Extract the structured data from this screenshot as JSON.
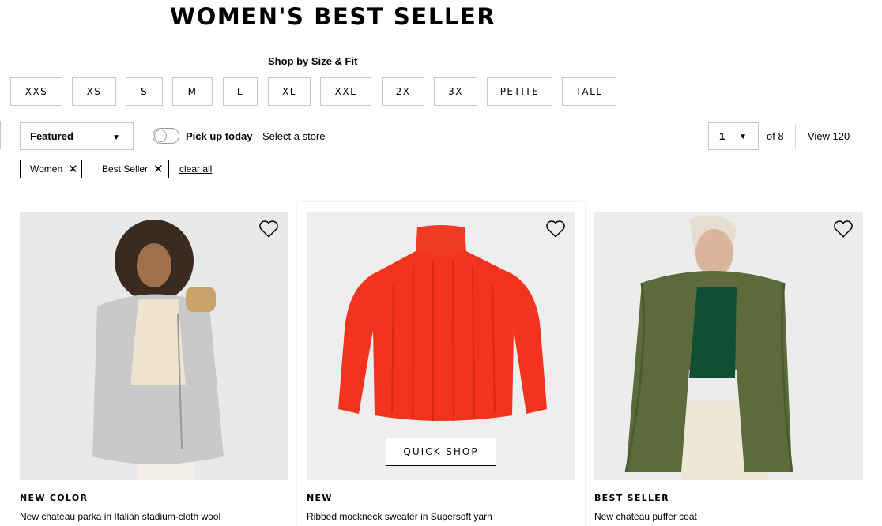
{
  "page": {
    "title": "WOMEN'S BEST SELLER"
  },
  "size_filter": {
    "heading": "Shop by Size & Fit",
    "sizes": [
      "XXS",
      "XS",
      "S",
      "M",
      "L",
      "XL",
      "XXL",
      "2X",
      "3X",
      "PETITE",
      "TALL"
    ]
  },
  "toolbar": {
    "sort_value": "Featured",
    "pickup_label": "Pick up today",
    "pickup_enabled": false,
    "store_link": "Select a store",
    "page_value": "1",
    "page_of": "of 8",
    "view_count": "View 120"
  },
  "active_filters": {
    "chips": [
      "Women",
      "Best Seller"
    ],
    "clear_all": "clear all"
  },
  "products": [
    {
      "badge": "NEW COLOR",
      "name": "New chateau parka in Italian stadium-cloth wool",
      "image": "woman in grey parka with fur-trimmed hood",
      "image_color": "#c9c9c9"
    },
    {
      "badge": "NEW",
      "name": "Ribbed mockneck sweater in Supersoft yarn",
      "image": "red ribbed mockneck sweater",
      "image_color": "#f4331f",
      "quick_shop": "QUICK SHOP"
    },
    {
      "badge": "BEST SELLER",
      "name": "New chateau puffer coat",
      "image": "woman in olive green puffer coat",
      "image_color": "#5d6b3c"
    }
  ],
  "icons": {
    "wishlist": "heart-outline-icon",
    "remove": "close-icon",
    "dropdown": "caret-down-icon"
  }
}
